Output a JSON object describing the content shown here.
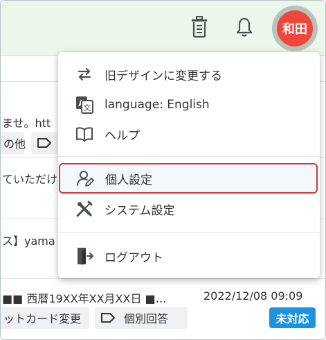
{
  "header": {
    "user_avatar_text": "和田"
  },
  "menu": {
    "items": [
      {
        "label": "旧デザインに変更する",
        "icon": "swap-arrows-icon"
      },
      {
        "label": "language: English",
        "icon": "translate-icon"
      },
      {
        "label": "ヘルプ",
        "icon": "book-icon"
      },
      {
        "label": "個人設定",
        "icon": "user-edit-icon"
      },
      {
        "label": "システム設定",
        "icon": "tools-icon"
      },
      {
        "label": "ログアウト",
        "icon": "logout-door-icon"
      }
    ],
    "highlight_color": "#d9332b"
  },
  "background": {
    "row1_text": "ませ。htt",
    "row1_chip": "の他",
    "row2_text": "ていただけ",
    "row3_text": "ス】yama",
    "row4_text": "■■ 西暦19XX年XX月XX日 ■…",
    "row4_datetime": "2022/12/08 09:09",
    "row4_chip1": "ットカード変更",
    "row4_chip2": "個別回答",
    "row4_status": "未対応"
  },
  "colors": {
    "header_bg": "#eaf7ea",
    "avatar_bg": "#f0463b",
    "status_badge_bg": "#1d93df"
  }
}
